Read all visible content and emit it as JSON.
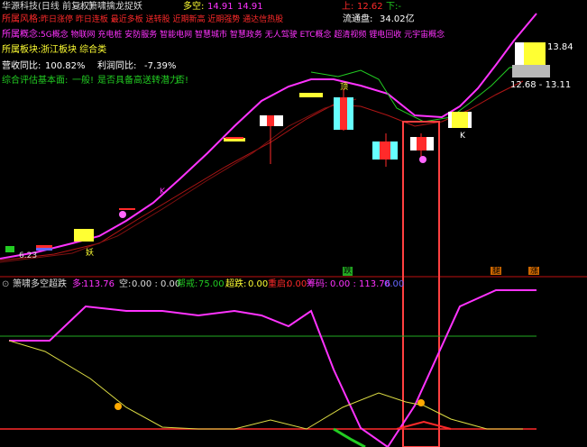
{
  "colors": {
    "bg": "#000000",
    "red": "#ff2a2a",
    "green": "#22cc22",
    "magenta": "#ff33ff",
    "yellow": "#ffff33",
    "cyan": "#66ffff",
    "white": "#ffffff",
    "grid": "#c01010"
  },
  "header": {
    "stock_title": "华源科技(日线 前复权)",
    "indicator_title": "箫啸擒龙捉妖",
    "duokong_label": "多空:",
    "duokong_value1": "14.91",
    "duokong_value2": "14.91",
    "up_label": "上:",
    "up_value": "12.62",
    "down_label": "下:-",
    "circulation_label": "流通盘:",
    "circulation_value": "34.02亿"
  },
  "info": {
    "risk_label": "所属风格:",
    "risk_items": "昨日涨停 昨日连板 最近多板 送转股 近期新高 近期强势 通达信热股",
    "concept_label": "所属概念:",
    "concept_items": "5G概念 物联网 充电桩 安防服务 智能电网 智慧城市 智慧政务 无人驾驶 ETC概念 超清视频 锂电回收 元宇宙概念",
    "sector_label": "所属板块:",
    "sector_items": "浙江板块  综合类",
    "revenue_label": "营收同比:",
    "revenue_value": "100.82%",
    "profit_label": "利润同比:",
    "profit_value": "-7.39%",
    "fund_label": "综合评估基本面:",
    "fund_value": "一般!",
    "potential_label": "是否具备高送转潜力:",
    "potential_value": "否!"
  },
  "price_labels": {
    "high_label": "13.84",
    "range_label": "12.68 - 13.11"
  },
  "markers": {
    "ding": "顶",
    "k1": "K",
    "k2": "K",
    "yao": "妖",
    "tao": "逃",
    "tie": "铁",
    "die": "跌",
    "tui": "腿",
    "zhang": "涨",
    "price623": "6.23"
  },
  "sub": {
    "title": "箫啸多空超跌",
    "duo_label": "多:",
    "duo_value": "113.76",
    "kong_label": "空:",
    "kong_value": "0.00 : 0.00",
    "bang_label": "帮戒:",
    "bang_value": "75.00",
    "chaodie_label": "超跌:",
    "chaodie_value": "0.00",
    "zhongzhen_label": "重启:",
    "zhongzhen_value": "0.00",
    "zhuma_label": "筹码:",
    "zhuma_value": "0.00 : 113.76",
    "tail_value": "0.00"
  }
}
